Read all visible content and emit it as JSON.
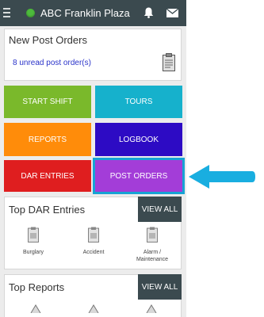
{
  "header": {
    "title": "ABC Franklin Plaza",
    "status_color": "#4dbb3c"
  },
  "post_orders_card": {
    "title": "New Post Orders",
    "unread_text": "8 unread post order(s)"
  },
  "tiles": {
    "start_shift": "START SHIFT",
    "tours": "TOURS",
    "reports": "REPORTS",
    "logbook": "LOGBOOK",
    "dar_entries": "DAR ENTRIES",
    "post_orders": "POST ORDERS"
  },
  "top_dar": {
    "title": "Top DAR Entries",
    "view_all": "VIEW ALL",
    "entries": [
      "Burglary",
      "Accident",
      "Alarm / Maintenance"
    ]
  },
  "top_reports": {
    "title": "Top Reports",
    "view_all": "VIEW ALL"
  },
  "colors": {
    "topbar": "#3b4a4f",
    "highlight": "#17a3d4"
  }
}
